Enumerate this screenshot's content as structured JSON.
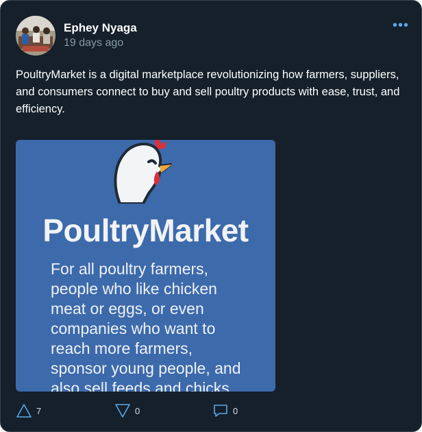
{
  "post": {
    "author": "Ephey Nyaga",
    "timestamp": "19 days ago",
    "menu_label": "•••",
    "text": "PoultryMarket is a digital marketplace revolutionizing how farmers, suppliers, and consumers connect to buy and sell poultry products with ease, trust, and efficiency."
  },
  "media": {
    "brand": "PoultryMarket",
    "tagline": "For all poultry farmers,\npeople who like chicken\nmeat or eggs, or even\ncompanies who want to\nreach more farmers,\nsponsor young people, and\nalso sell feeds and chicks.",
    "background_color": "#3d6aab",
    "icon": "chicken-logo"
  },
  "actions": {
    "upvotes": "7",
    "downvotes": "0",
    "comments": "0"
  },
  "colors": {
    "card_background": "#15202b",
    "accent": "#5aa8e6",
    "muted_text": "#8899a6"
  }
}
